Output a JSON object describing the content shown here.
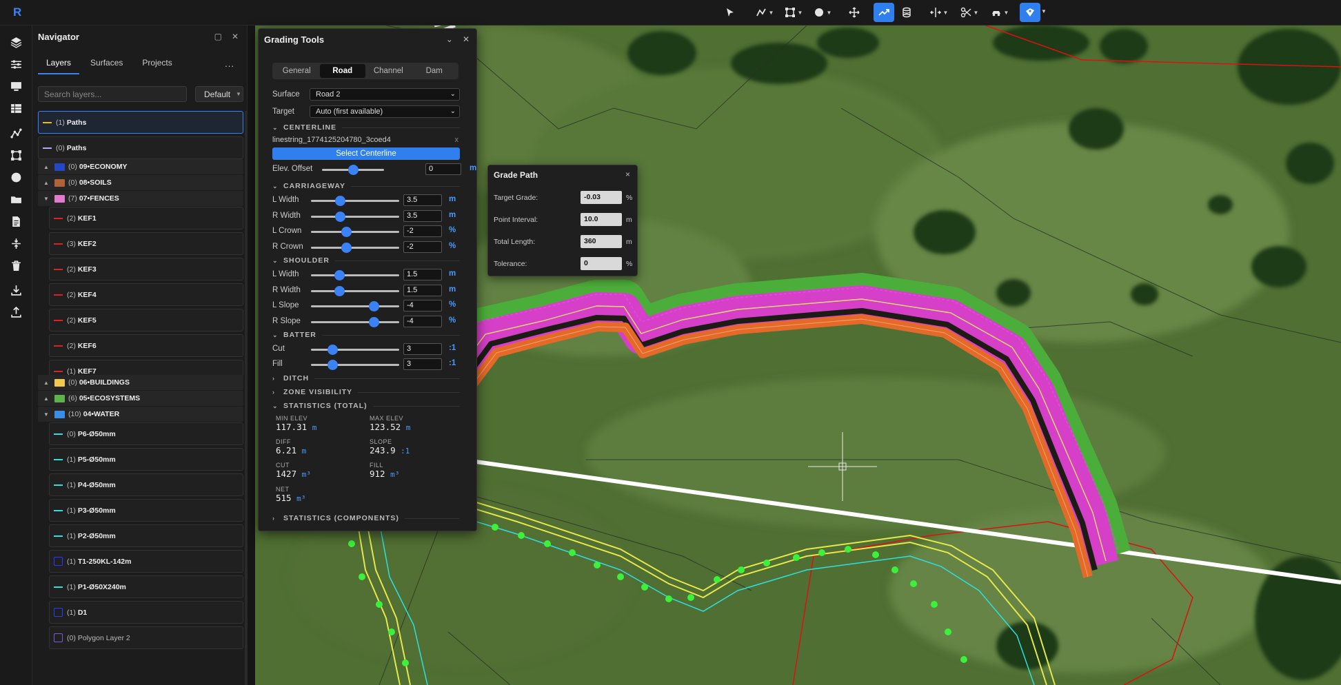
{
  "app": {
    "logo": "R"
  },
  "toolbar": {
    "tools": [
      "pointer-tool",
      "polyline-tool",
      "node-tool",
      "circle-tool",
      "move-tool",
      "grade-tool",
      "cylinder-tool",
      "split-tool",
      "cut-tool",
      "vehicle-tool",
      "map-tool"
    ]
  },
  "navigator": {
    "title": "Navigator",
    "tabs": [
      "Layers",
      "Surfaces",
      "Projects"
    ],
    "more": "...",
    "search_placeholder": "Search layers...",
    "filter_label": "Default",
    "layers": [
      {
        "count": "(1)",
        "name": "Paths",
        "kind": "line",
        "color": "#e6c200",
        "selected": true
      },
      {
        "count": "(0)",
        "name": "Paths",
        "kind": "line",
        "color": "#b9a6ff"
      },
      {
        "count": "(0)",
        "name": "09•ECONOMY",
        "kind": "group",
        "color": "#2446c8",
        "arrow": "▲"
      },
      {
        "count": "(0)",
        "name": "08•SOILS",
        "kind": "group",
        "color": "#b0623a",
        "arrow": "▲"
      },
      {
        "count": "(7)",
        "name": "07•FENCES",
        "kind": "group",
        "color": "#e27ad0",
        "arrow": "▼"
      },
      {
        "count": "(2)",
        "name": "KEF1",
        "kind": "line",
        "color": "#d22",
        "indent": true
      },
      {
        "count": "(3)",
        "name": "KEF2",
        "kind": "line",
        "color": "#d22",
        "indent": true
      },
      {
        "count": "(2)",
        "name": "KEF3",
        "kind": "line",
        "color": "#d22",
        "indent": true
      },
      {
        "count": "(2)",
        "name": "KEF4",
        "kind": "line",
        "color": "#d22",
        "indent": true
      },
      {
        "count": "(2)",
        "name": "KEF5",
        "kind": "line",
        "color": "#d22",
        "indent": true
      },
      {
        "count": "(2)",
        "name": "KEF6",
        "kind": "line",
        "color": "#d22",
        "indent": true
      },
      {
        "count": "(1)",
        "name": "KEF7",
        "kind": "line",
        "color": "#d22",
        "indent": true
      },
      {
        "count": "(0)",
        "name": "06•BUILDINGS",
        "kind": "group",
        "color": "#f2c94c",
        "arrow": "▲"
      },
      {
        "count": "(6)",
        "name": "05•ECOSYSTEMS",
        "kind": "group",
        "color": "#5cb34a",
        "arrow": "▲"
      },
      {
        "count": "(10)",
        "name": "04•WATER",
        "kind": "group",
        "color": "#3a8ee6",
        "arrow": "▼"
      },
      {
        "count": "(0)",
        "name": "P6-Ø50mm",
        "kind": "line",
        "color": "#2ee0e0",
        "indent": true
      },
      {
        "count": "(1)",
        "name": "P5-Ø50mm",
        "kind": "line",
        "color": "#2ee0e0",
        "indent": true
      },
      {
        "count": "(1)",
        "name": "P4-Ø50mm",
        "kind": "line",
        "color": "#2ee0e0",
        "indent": true
      },
      {
        "count": "(1)",
        "name": "P3-Ø50mm",
        "kind": "line",
        "color": "#2ee0e0",
        "indent": true
      },
      {
        "count": "(1)",
        "name": "P2-Ø50mm",
        "kind": "line",
        "color": "#2ee0e0",
        "indent": true
      },
      {
        "count": "(1)",
        "name": "T1-250KL-142m",
        "kind": "square",
        "color": "#2b3bff",
        "indent": true
      },
      {
        "count": "(1)",
        "name": "P1-Ø50X240m",
        "kind": "line",
        "color": "#2ee0e0",
        "indent": true
      },
      {
        "count": "(1)",
        "name": "D1",
        "kind": "square",
        "color": "#2b3bff",
        "indent": true
      },
      {
        "count": "(0)",
        "name": "Polygon Layer 2",
        "kind": "square",
        "color": "#7a5ad8",
        "indent": true,
        "dim": true
      }
    ]
  },
  "grading": {
    "title": "Grading Tools",
    "tabs": [
      "General",
      "Road",
      "Channel",
      "Dam"
    ],
    "active_tab": "Road",
    "surface_label": "Surface",
    "surface_value": "Road 2",
    "target_label": "Target",
    "target_value": "Auto (first available)",
    "centerline_title": "CENTERLINE",
    "centerline_id": "linestring_1774125204780_3coed4",
    "centerline_clear": "x",
    "select_btn": "Select Centerline",
    "elev_label": "Elev. Offset",
    "elev_value": "0",
    "elev_unit": "m",
    "elev_level": 0.5,
    "carriageway_title": "CARRIAGEWAY",
    "shoulder_title": "SHOULDER",
    "batter_title": "BATTER",
    "ditch_title": "DITCH",
    "zone_title": "ZONE VISIBILITY",
    "stats_title": "STATISTICS (TOTAL)",
    "comp_title": "STATISTICS (COMPONENTS)",
    "carriageway": [
      {
        "label": "L Width",
        "value": "3.5",
        "unit": "m",
        "level": 0.33
      },
      {
        "label": "R Width",
        "value": "3.5",
        "unit": "m",
        "level": 0.33
      },
      {
        "label": "L Crown",
        "value": "-2",
        "unit": "%",
        "level": 0.4
      },
      {
        "label": "R Crown",
        "value": "-2",
        "unit": "%",
        "level": 0.4
      }
    ],
    "shoulder": [
      {
        "label": "L Width",
        "value": "1.5",
        "unit": "m",
        "level": 0.32
      },
      {
        "label": "R Width",
        "value": "1.5",
        "unit": "m",
        "level": 0.32
      },
      {
        "label": "L Slope",
        "value": "-4",
        "unit": "%",
        "level": 0.71
      },
      {
        "label": "R Slope",
        "value": "-4",
        "unit": "%",
        "level": 0.71
      }
    ],
    "batter": [
      {
        "label": "Cut",
        "value": "3",
        "unit": ":1",
        "level": 0.24
      },
      {
        "label": "Fill",
        "value": "3",
        "unit": ":1",
        "level": 0.24
      }
    ],
    "stats": [
      {
        "k": "MIN ELEV",
        "v": "117.31",
        "u": "m"
      },
      {
        "k": "MAX ELEV",
        "v": "123.52",
        "u": "m"
      },
      {
        "k": "DIFF",
        "v": "6.21",
        "u": "m"
      },
      {
        "k": "SLOPE",
        "v": "243.9",
        "u": ":1"
      },
      {
        "k": "CUT",
        "v": "1427",
        "u": "m³"
      },
      {
        "k": "FILL",
        "v": "912",
        "u": "m³"
      },
      {
        "k": "NET",
        "v": "515",
        "u": "m³"
      }
    ]
  },
  "grade_path": {
    "title": "Grade Path",
    "close": "×",
    "rows": [
      {
        "label": "Target Grade:",
        "value": "-0.03",
        "unit": "%"
      },
      {
        "label": "Point Interval:",
        "value": "10.0",
        "unit": "m"
      },
      {
        "label": "Total Length:",
        "value": "360",
        "unit": "m"
      },
      {
        "label": "Tolerance:",
        "value": "0",
        "unit": "%"
      }
    ]
  }
}
